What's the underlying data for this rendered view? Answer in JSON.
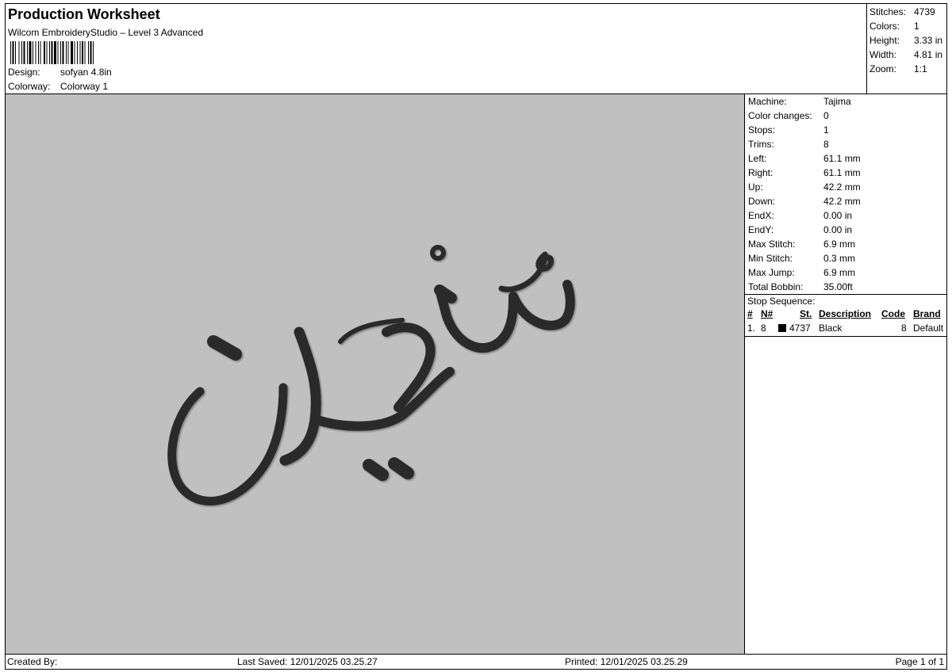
{
  "header": {
    "title": "Production Worksheet",
    "software": "Wilcom EmbroideryStudio – Level 3 Advanced",
    "design_label": "Design:",
    "design_value": "sofyan 4.8in",
    "colorway_label": "Colorway:",
    "colorway_value": "Colorway 1"
  },
  "summary": [
    {
      "label": "Stitches:",
      "value": "4739"
    },
    {
      "label": "Colors:",
      "value": "1"
    },
    {
      "label": "Height:",
      "value": "3.33 in"
    },
    {
      "label": "Width:",
      "value": "4.81 in"
    },
    {
      "label": "Zoom:",
      "value": "1:1"
    }
  ],
  "design_preview": {
    "background": "#c0c0c0",
    "thread_color": "#2b2b2b",
    "text": "سُفْيَان"
  },
  "stats": [
    {
      "label": "Machine:",
      "value": "Tajima"
    },
    {
      "label": "Color changes:",
      "value": "0"
    },
    {
      "label": "Stops:",
      "value": "1"
    },
    {
      "label": "Trims:",
      "value": "8"
    },
    {
      "label": "Left:",
      "value": "61.1 mm"
    },
    {
      "label": "Right:",
      "value": "61.1 mm"
    },
    {
      "label": "Up:",
      "value": "42.2 mm"
    },
    {
      "label": "Down:",
      "value": "42.2 mm"
    },
    {
      "label": "EndX:",
      "value": "0.00 in"
    },
    {
      "label": "EndY:",
      "value": "0.00 in"
    },
    {
      "label": "Max Stitch:",
      "value": "6.9 mm"
    },
    {
      "label": "Min Stitch:",
      "value": "0.3 mm"
    },
    {
      "label": "Max Jump:",
      "value": "6.9 mm"
    },
    {
      "label": "Total Bobbin:",
      "value": "35.00ft"
    }
  ],
  "stop_sequence": {
    "title": "Stop Sequence:",
    "columns": [
      "#",
      "N#",
      "St.",
      "Description",
      "Code",
      "Brand"
    ],
    "rows": [
      {
        "index": "1.",
        "needle": "8",
        "swatch_color": "#000000",
        "stitches": "4737",
        "description": "Black",
        "code": "8",
        "brand": "Default"
      }
    ]
  },
  "footer": {
    "created_by": "Created By:",
    "last_saved": "Last Saved: 12/01/2025 03.25.27",
    "printed": "Printed: 12/01/2025 03.25.29",
    "page": "Page 1 of 1"
  }
}
